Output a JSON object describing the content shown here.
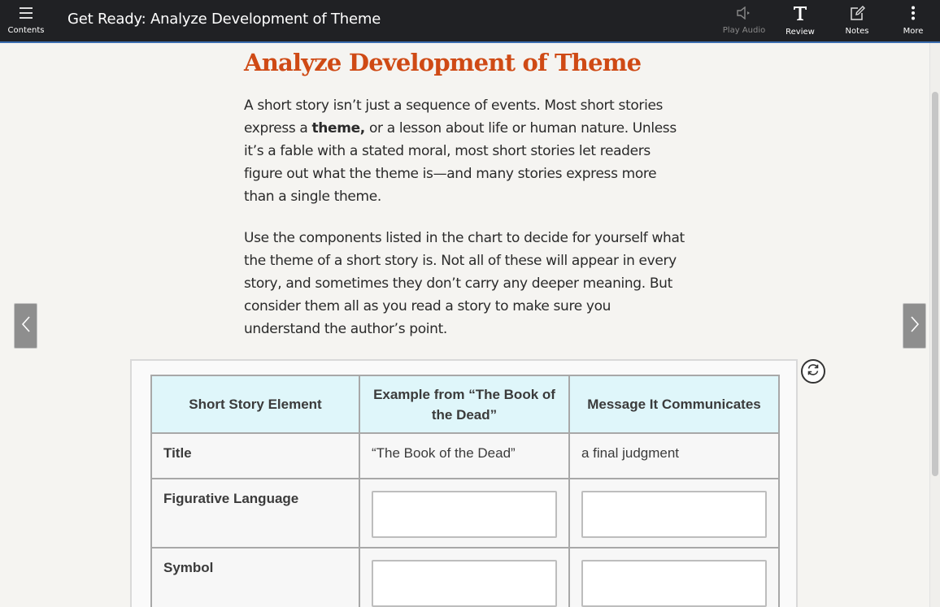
{
  "topbar": {
    "contents_label": "Contents",
    "title": "Get Ready: Analyze Development of Theme",
    "play_audio_label": "Play Audio",
    "review_label": "Review",
    "notes_label": "Notes",
    "more_label": "More"
  },
  "main": {
    "heading": "Analyze Development of Theme",
    "para1_before": "A short story isn’t just a sequence of events. Most short stories express a ",
    "para1_bold": "theme,",
    "para1_after": " or a lesson about life or human nature. Unless it’s a fable with a stated moral, most short stories let readers figure out what the theme is—and many stories express more than a single theme.",
    "para2": "Use the components listed in the chart to decide for yourself what the theme of a short story is. Not all of these will appear in every story, and sometimes they don’t carry any deeper meaning. But consider them all as you read a story to make sure you understand the author’s point."
  },
  "table": {
    "headers": [
      "Short Story Element",
      "Example from “The Book of the Dead”",
      "Message It Communicates"
    ],
    "rows": [
      {
        "element": "Title",
        "example": "“The Book of the Dead”",
        "message": "a final judgment"
      },
      {
        "element": "Figurative Language",
        "example": "",
        "message": ""
      },
      {
        "element": "Symbol",
        "example": "",
        "message": ""
      }
    ]
  },
  "icons": {
    "contents": "hamburger-icon",
    "audio": "speaker-icon",
    "review": "text-T-icon",
    "notes": "pencil-note-icon",
    "more": "vertical-dots-icon",
    "refresh": "refresh-icon",
    "prev": "chevron-left-icon",
    "next": "chevron-right-icon"
  },
  "colors": {
    "topbar": "#202124",
    "heading": "#cf4a15",
    "table_header": "#dff6fa"
  }
}
